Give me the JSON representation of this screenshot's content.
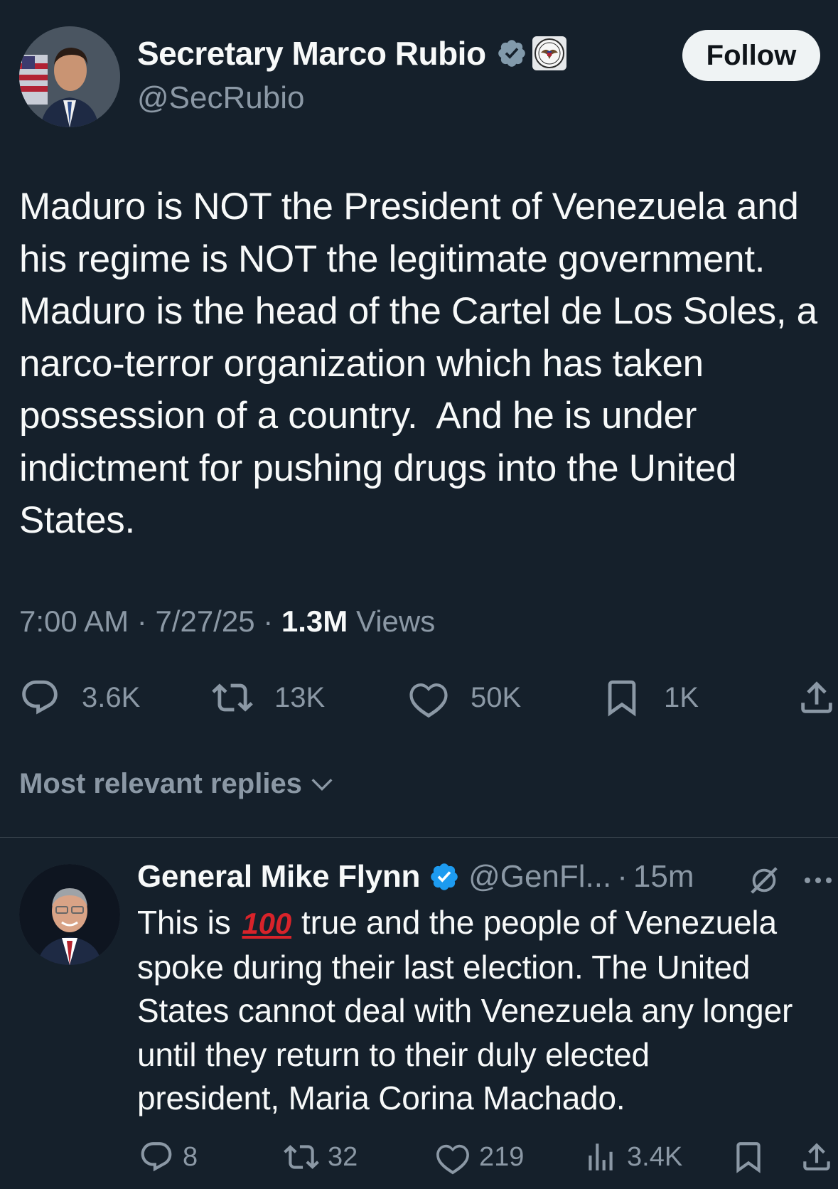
{
  "tweet": {
    "author_name": "Secretary Marco Rubio",
    "handle": "@SecRubio",
    "follow_label": "Follow",
    "text": "Maduro is NOT the President of Venezuela and\nhis regime is NOT the legitimate government.\nMaduro is the head of the Cartel de Los Soles, a\nnarco-terror organization which has taken\npossession of a country.  And he is under\nindictment for pushing drugs into the United\nStates.",
    "time": "7:00 AM",
    "date": "7/27/25",
    "views_count": "1.3M",
    "views_label": "Views",
    "stats": {
      "replies": "3.6K",
      "reposts": "13K",
      "likes": "50K",
      "bookmarks": "1K"
    }
  },
  "replies_filter_label": "Most relevant replies",
  "reply": {
    "author_name": "General Mike Flynn",
    "handle": "@GenFl...",
    "time": "15m",
    "text_before": "This is",
    "emoji_text": "100",
    "text_after": "true and the people of Venezuela\nspoke during their last election. The United\nStates cannot deal with Venezuela any longer\nuntil they return to their duly elected\npresident, Maria Corina Machado.",
    "stats": {
      "replies": "8",
      "reposts": "32",
      "likes": "219",
      "views": "3.4K"
    }
  },
  "colors": {
    "background": "#15202b",
    "secondary_text": "#8b98a5",
    "verified_blue": "#1d9bf0",
    "verified_gray": "#829aab",
    "emoji_red": "#d8232a"
  },
  "icons": {
    "author_badges": [
      "verified-gray-icon",
      "state-department-seal-icon"
    ],
    "reply_badge": "verified-blue-icon",
    "actions": [
      "reply-icon",
      "repost-icon",
      "like-icon",
      "bookmark-icon",
      "share-icon"
    ],
    "reply_actions": [
      "reply-icon",
      "repost-icon",
      "like-icon",
      "views-icon",
      "bookmark-icon",
      "share-icon"
    ],
    "reply_extras": [
      "grok-icon",
      "more-icon"
    ],
    "filter": "chevron-down-icon"
  }
}
